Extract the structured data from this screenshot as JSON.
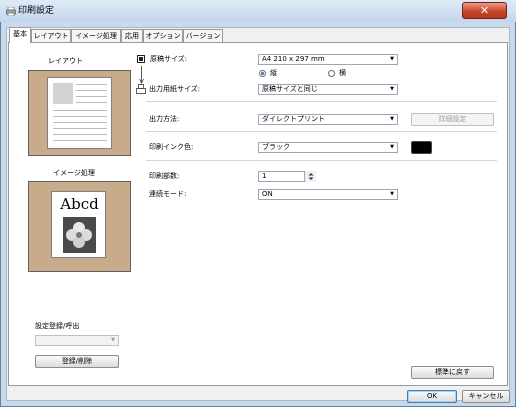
{
  "window": {
    "title": "印刷設定",
    "close": "✕"
  },
  "tabs": [
    "基本",
    "レイアウト",
    "イメージ処理",
    "応用",
    "オプション",
    "バージョン"
  ],
  "left": {
    "layout_label": "レイアウト",
    "image_label": "イメージ処理",
    "sample_text": "Abcd",
    "settings_label": "設定登録/呼出",
    "settings_combo": "",
    "register_button": "登録/削除"
  },
  "form": {
    "paper_size": {
      "label": "原稿サイズ:",
      "value": "A4 210 x 297 mm"
    },
    "orientation": {
      "portrait": "縦",
      "landscape": "横",
      "selected": "portrait"
    },
    "output_paper_size": {
      "label": "出力用紙サイズ:",
      "value": "原稿サイズと同じ"
    },
    "output_method": {
      "label": "出力方法:",
      "value": "ダイレクトプリント",
      "detail_button": "詳細設定"
    },
    "ink_color": {
      "label": "印刷インク色:",
      "value": "ブラック",
      "swatch": "#000000"
    },
    "copies": {
      "label": "印刷部数:",
      "value": "1"
    },
    "continuous_mode": {
      "label": "連続モード:",
      "value": "ON"
    }
  },
  "buttons": {
    "reset": "標準に戻す",
    "ok": "OK",
    "cancel": "キャンセル"
  }
}
